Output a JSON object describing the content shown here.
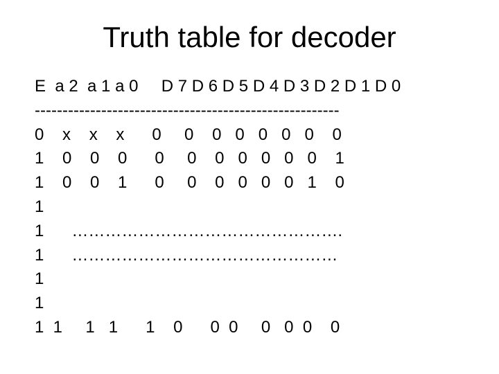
{
  "title": "Truth table for decoder",
  "header_line": "E  a 2  a 1 a 0     D 7 D 6 D 5 D 4 D 3 D 2 D 1 D 0",
  "divider": "-------------------------------------------------------",
  "rows": {
    "r0": "0    x    x    x      0     0    0   0   0   0   0    0",
    "r1": "1    0    0    0      0     0    0   0   0   0   0    1",
    "r2": "1    0    0    1      0     0    0   0   0   0   1    0",
    "r3": "1",
    "r4": "1      ………………………………………….",
    "r5": "1      …………………………………………",
    "r6": "1",
    "r7": "1",
    "r8": "1  1     1   1      1    0      0  0     0   0  0    0"
  }
}
